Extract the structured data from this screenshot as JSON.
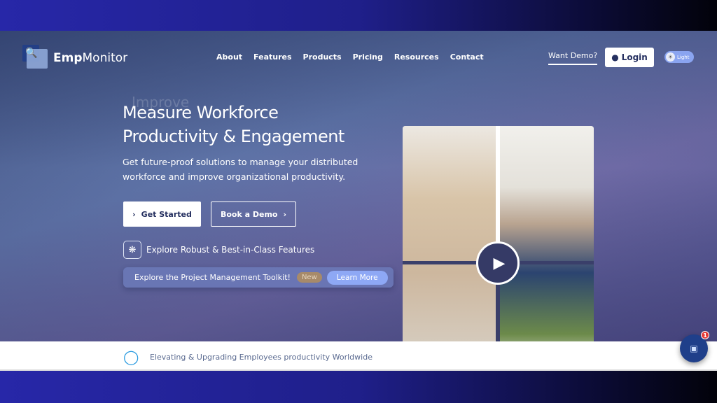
{
  "brand": {
    "bold": "Emp",
    "rest": "Monitor"
  },
  "nav": [
    "About",
    "Features",
    "Products",
    "Pricing",
    "Resources",
    "Contact"
  ],
  "header": {
    "want_demo": "Want Demo?",
    "login": "Login",
    "theme_toggle": "Light"
  },
  "hero": {
    "ghost_word": "Improve",
    "title_line1": "Measure Workforce",
    "title_line2": "Productivity & Engagement",
    "subtitle": "Get future-proof solutions to manage your distributed workforce and improve organizational productivity.",
    "get_started": "Get Started",
    "book_demo": "Book a Demo",
    "explore_features": "Explore Robust & Best-in-Class Features",
    "toolkit_text": "Explore the Project Management Toolkit!",
    "new_badge": "New",
    "learn_more": "Learn More"
  },
  "strip": {
    "text": "Elevating & Upgrading Employees productivity Worldwide"
  },
  "chat": {
    "unread": "1"
  },
  "colors": {
    "accent": "#8ea8f5",
    "navy": "#253060",
    "shield": "#2a9be0"
  }
}
